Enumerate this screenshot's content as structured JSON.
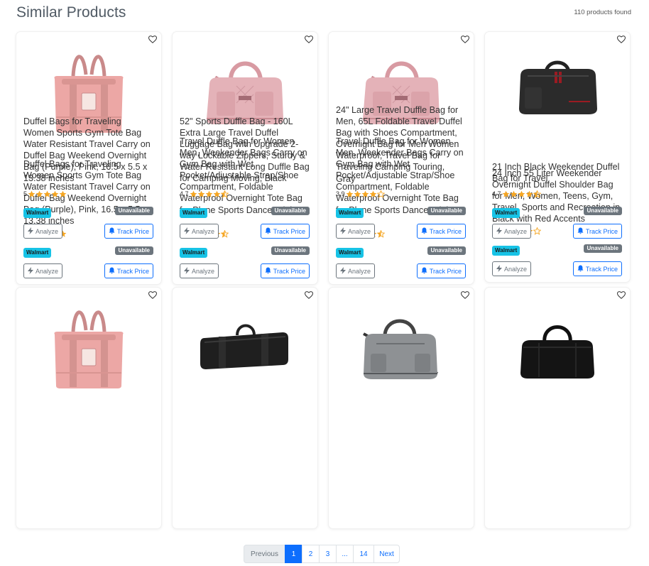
{
  "header": {
    "title": "Similar Products",
    "count": "110 products found"
  },
  "colors": {
    "accent": "#0d6efd",
    "store_badge": "#17c3e6",
    "unavailable_badge": "#6c757d",
    "star": "#f5a623"
  },
  "products": [
    {
      "title": "Duffel Bags for Traveling Women Sports Gym Tote Bag Water Resistant Travel Carry on Duffel Bag Weekend Overnight Bag (Purple), Pink, 16.5 x 5.5 x 13.38 inches",
      "rating": "5",
      "rating_value": 5,
      "store": "Walmart",
      "availability": "Unavailable",
      "analyze_label": "Analyze",
      "track_label": "Track Price",
      "image_icon": "pink-foldable-tote-bag"
    },
    {
      "title": "Travel Duffle Bag for Women Men, Weekender Bags Carry on Gym Bag with Wet Pocket/Adjustable Strap/Shoe Compartment, Foldable Waterproof Overnight Tote Bag for Plane Sports Dance, Pink",
      "rating": "4.4",
      "rating_value": 4.4,
      "store": "Walmart",
      "availability": "Unavailable",
      "analyze_label": "Analyze",
      "track_label": "Track Price",
      "image_icon": "pink-quilted-duffle-bag"
    },
    {
      "title": "Travel Duffle Bag for Women Men, Weekender Bags Carry on Gym Bag with Wet Pocket/Adjustable Strap/Shoe Compartment, Foldable Waterproof Overnight Tote Bag for Plane Sports Dance, Pink",
      "rating": "4.4",
      "rating_value": 4.4,
      "store": "Walmart",
      "availability": "Unavailable",
      "analyze_label": "Analyze",
      "track_label": "Track Price",
      "image_icon": "pink-quilted-duffle-bag"
    },
    {
      "title": "24 Inch 55 Liter Weekender Overnight Duffel Shoulder Bag for Men, Women, Teens, Gym, Travel, Sports and Recreation in Black with Red Accents",
      "rating": "4.1",
      "rating_value": 4.1,
      "store": "Walmart",
      "availability": "Unavailable",
      "analyze_label": "Analyze",
      "track_label": "Track Price",
      "image_icon": "black-duffel-bag-red-accents"
    },
    {
      "title": "Duffel Bags for Traveling Women Sports Gym Tote Bag Water Resistant Travel Carry on Duffel Bag Weekend Overnight Bag (Purple), Pink, 16.5 x 5.5 x 13.38 inches",
      "rating": "5",
      "rating_value": 5,
      "store": "Walmart",
      "availability": "Unavailable",
      "analyze_label": "Analyze",
      "track_label": "Track Price",
      "image_icon": "pink-foldable-tote-bag"
    },
    {
      "title": "52\" Sports Duffle Bag - 160L Extra Large Travel Duffel Luggage Bag with Upgrade 2-way Lockable Zippers, Sturdy & Water Resistant Long Duffle Bag for Camping Moving, Black",
      "rating": "4.7",
      "rating_value": 4.7,
      "store": "Walmart",
      "availability": "Unavailable",
      "analyze_label": "Analyze",
      "track_label": "Track Price",
      "image_icon": "long-black-duffle-bag"
    },
    {
      "title": "24\" Large Travel Duffle Bag for Men, 65L Foldable Travel Duffel Bag with Shoes Compartment, Overnight Bag for Men Women Waterproof, Travel Bag for Traveling Camping Touring, Gray",
      "rating": "3.9",
      "rating_value": 3.9,
      "store": "Walmart",
      "availability": "Unavailable",
      "analyze_label": "Analyze",
      "track_label": "Track Price",
      "image_icon": "gray-duffle-bag"
    },
    {
      "title": "21 Inch Black Weekender Duffel Bag for Travel",
      "rating": "4.7",
      "rating_value": 4.7,
      "store": "Walmart",
      "availability": "Unavailable",
      "analyze_label": "Analyze",
      "track_label": "Track Price",
      "image_icon": "black-weekender-bag"
    }
  ],
  "pagination": {
    "previous": "Previous",
    "pages": [
      "1",
      "2",
      "3",
      "...",
      "14"
    ],
    "next": "Next",
    "current": "1"
  }
}
